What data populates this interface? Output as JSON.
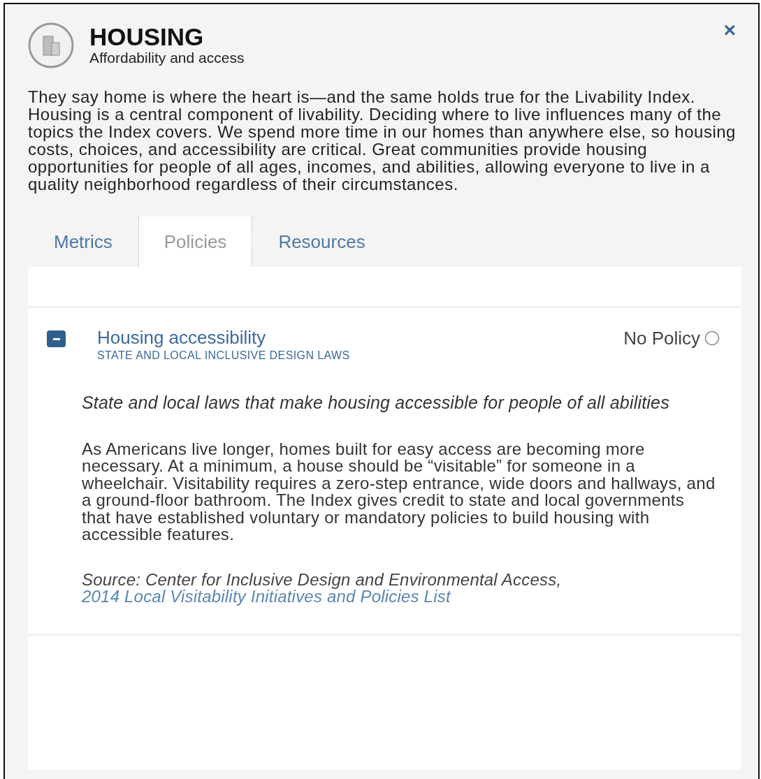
{
  "header": {
    "title": "HOUSING",
    "subtitle": "Affordability and access",
    "close": "×"
  },
  "intro": "They say home is where the heart is—and the same holds true for the Livability Index. Housing is a central component of livability. Deciding where to live influences many of the topics the Index covers. We spend more time in our homes than anywhere else, so housing costs, choices, and accessibility are critical. Great communities provide housing opportunities for people of all ages, incomes, and abilities, allowing everyone to live in a quality neighborhood regardless of their circumstances.",
  "tabs": [
    {
      "label": "Metrics",
      "selected": false
    },
    {
      "label": "Policies",
      "selected": true
    },
    {
      "label": "Resources",
      "selected": false
    }
  ],
  "policies": [
    {
      "title": "Housing accessibility",
      "subtitle": "STATE AND LOCAL INCLUSIVE DESIGN LAWS",
      "status": "No Policy",
      "expanded": true,
      "summary": "State and local laws that make housing accessible for people of all abilities",
      "body": "As Americans live longer, homes built for easy access are becoming more necessary. At a minimum, a house should be “visitable” for someone in a wheelchair. Visitability requires a zero-step entrance, wide doors and hallways, and a ground-floor bathroom. The Index gives credit to state and local governments that have established voluntary or mandatory policies to build housing with accessible features.",
      "source": "Source: Center for Inclusive Design and Environmental Access,",
      "source_link": "2014 Local Visitability Initiatives and Policies List"
    }
  ]
}
